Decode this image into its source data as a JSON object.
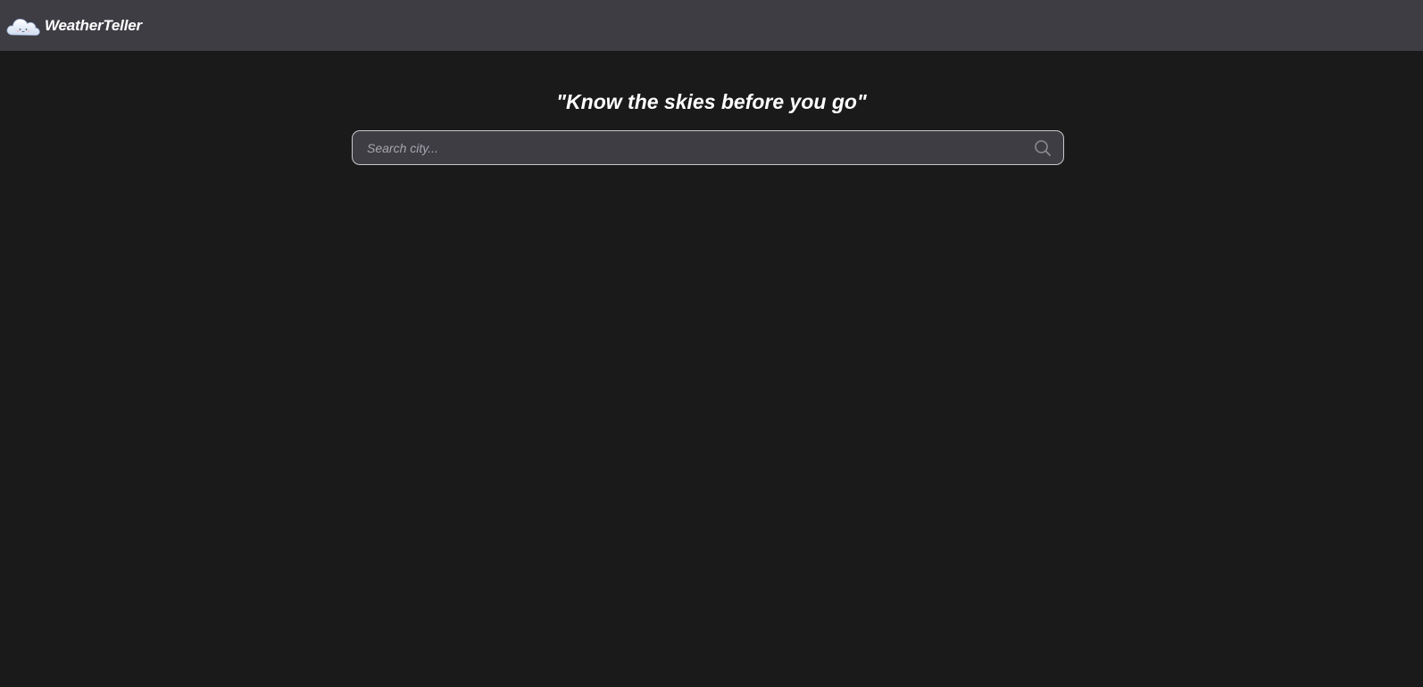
{
  "app": {
    "name": "WeatherTeller",
    "logo_icon": "cloud-icon"
  },
  "hero": {
    "tagline": "\"Know the skies before you go\""
  },
  "search": {
    "placeholder": "Search city...",
    "value": "",
    "icon": "search-icon"
  },
  "colors": {
    "background": "#1a1a1a",
    "topbar": "#3e3d44",
    "search_background": "#3e3d44",
    "search_border": "#c9c9cc",
    "text": "#ffffff",
    "placeholder": "#a7a7ad",
    "icon": "#8a8a90"
  }
}
